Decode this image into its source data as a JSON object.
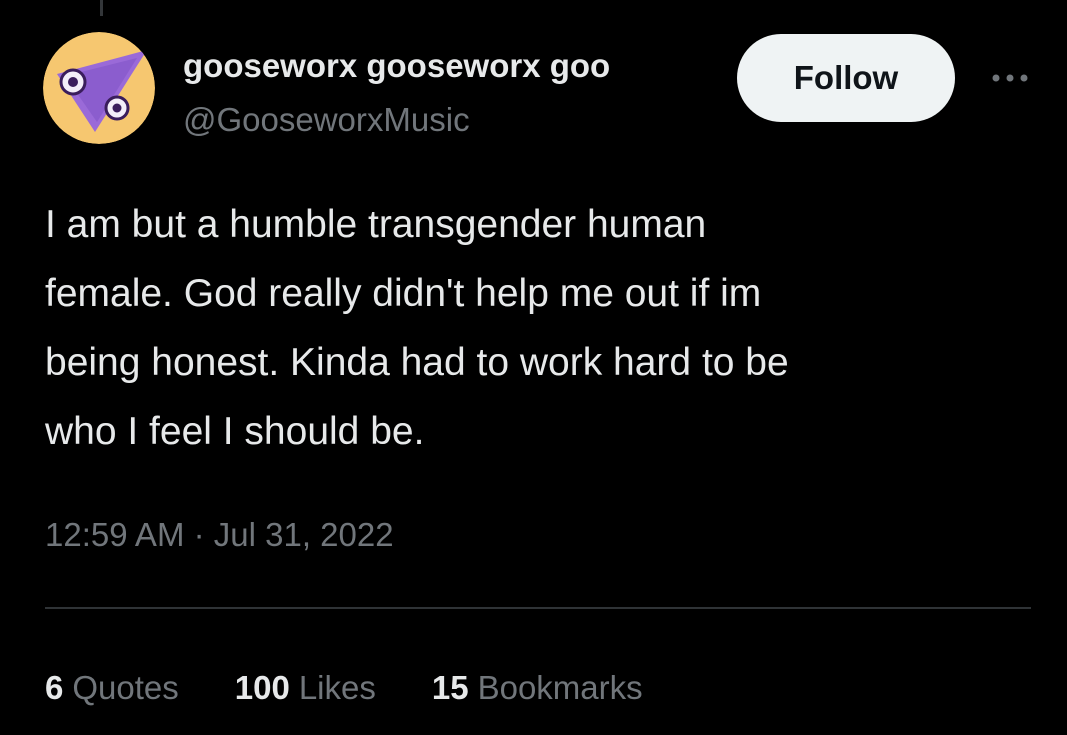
{
  "author": {
    "display_name": "gooseworx gooseworx goo",
    "handle": "@GooseworxMusic",
    "avatar": "avatar-triangle-eyes-icon"
  },
  "actions": {
    "follow_label": "Follow",
    "more_icon": "more-dots-icon"
  },
  "tweet": {
    "text": "I am but a humble transgender human\nfemale. God really didn't help me out if im\nbeing honest. Kinda had to work hard to be\nwho I feel I should be.",
    "timestamp": "12:59 AM · Jul 31, 2022"
  },
  "stats": [
    {
      "count": "6",
      "label": "Quotes"
    },
    {
      "count": "100",
      "label": "Likes"
    },
    {
      "count": "15",
      "label": "Bookmarks"
    }
  ],
  "colors": {
    "background": "#000000",
    "text_primary": "#e7e9ea",
    "text_secondary": "#71767b",
    "follow_bg": "#eff3f4",
    "divider": "#2f3336"
  }
}
